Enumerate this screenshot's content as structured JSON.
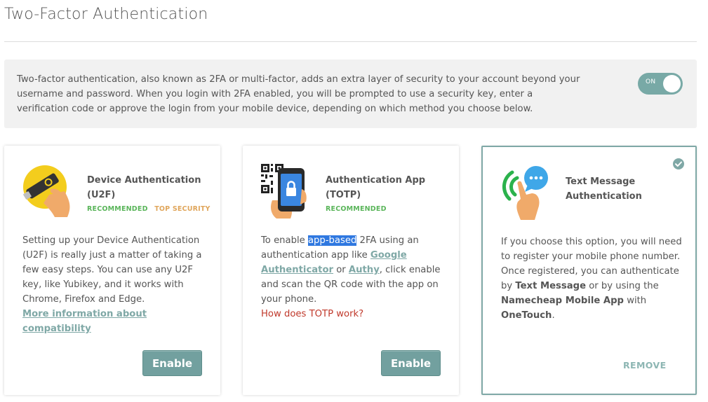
{
  "page": {
    "title": "Two-Factor Authentication"
  },
  "intro": {
    "text": "Two-factor authentication, also known as 2FA or multi-factor, adds an extra layer of security to your account beyond your username and password. When you login with 2FA enabled, you will be prompted to use a security key, enter a verification code or approve the login from your mobile device, depending on which method you choose below.",
    "toggle_label": "ON"
  },
  "colors": {
    "accent": "#78a9a6",
    "recommended": "#5ab55a",
    "top_security": "#e0a65c",
    "help_link": "#c0392b",
    "highlight": "#2f78e0"
  },
  "cards": [
    {
      "icon": "security-key-icon",
      "title_line1": "Device Authentication",
      "title_line2": "(U2F)",
      "badge_recommended": "RECOMMENDED",
      "badge_top_security": "TOP SECURITY",
      "body": "Setting up your Device Authentication (U2F) is really just a matter of taking a few easy steps. You can use any U2F key, like Yubikey, and it works with Chrome, Firefox and Edge.",
      "link": "More information about compatibility",
      "button": "Enable"
    },
    {
      "icon": "qr-phone-icon",
      "title_line1": "Authentication App",
      "title_line2": "(TOTP)",
      "badge_recommended": "RECOMMENDED",
      "body_pre": "To enable ",
      "body_highlight": "app-based",
      "body_mid1": " 2FA using an authentication app like ",
      "link_google": "Google Authenticator",
      "body_mid2": " or ",
      "link_authy": "Authy",
      "body_post": ", click enable and scan the QR code with the app on your phone.",
      "help_link": "How does TOTP work?",
      "button": "Enable"
    },
    {
      "icon": "text-message-icon",
      "title_line1": "Text Message",
      "title_line2": "Authentication",
      "body_pre": "If you choose this option, you will need to register your mobile phone number. Once registered, you can authenticate by ",
      "bold1": "Text Message",
      "body_mid": " or by using the ",
      "bold2": "Namecheap Mobile App",
      "body_mid2": " with ",
      "bold3": "OneTouch",
      "body_post": ".",
      "button": "REMOVE",
      "selected_icon": "check-circle-icon"
    }
  ]
}
